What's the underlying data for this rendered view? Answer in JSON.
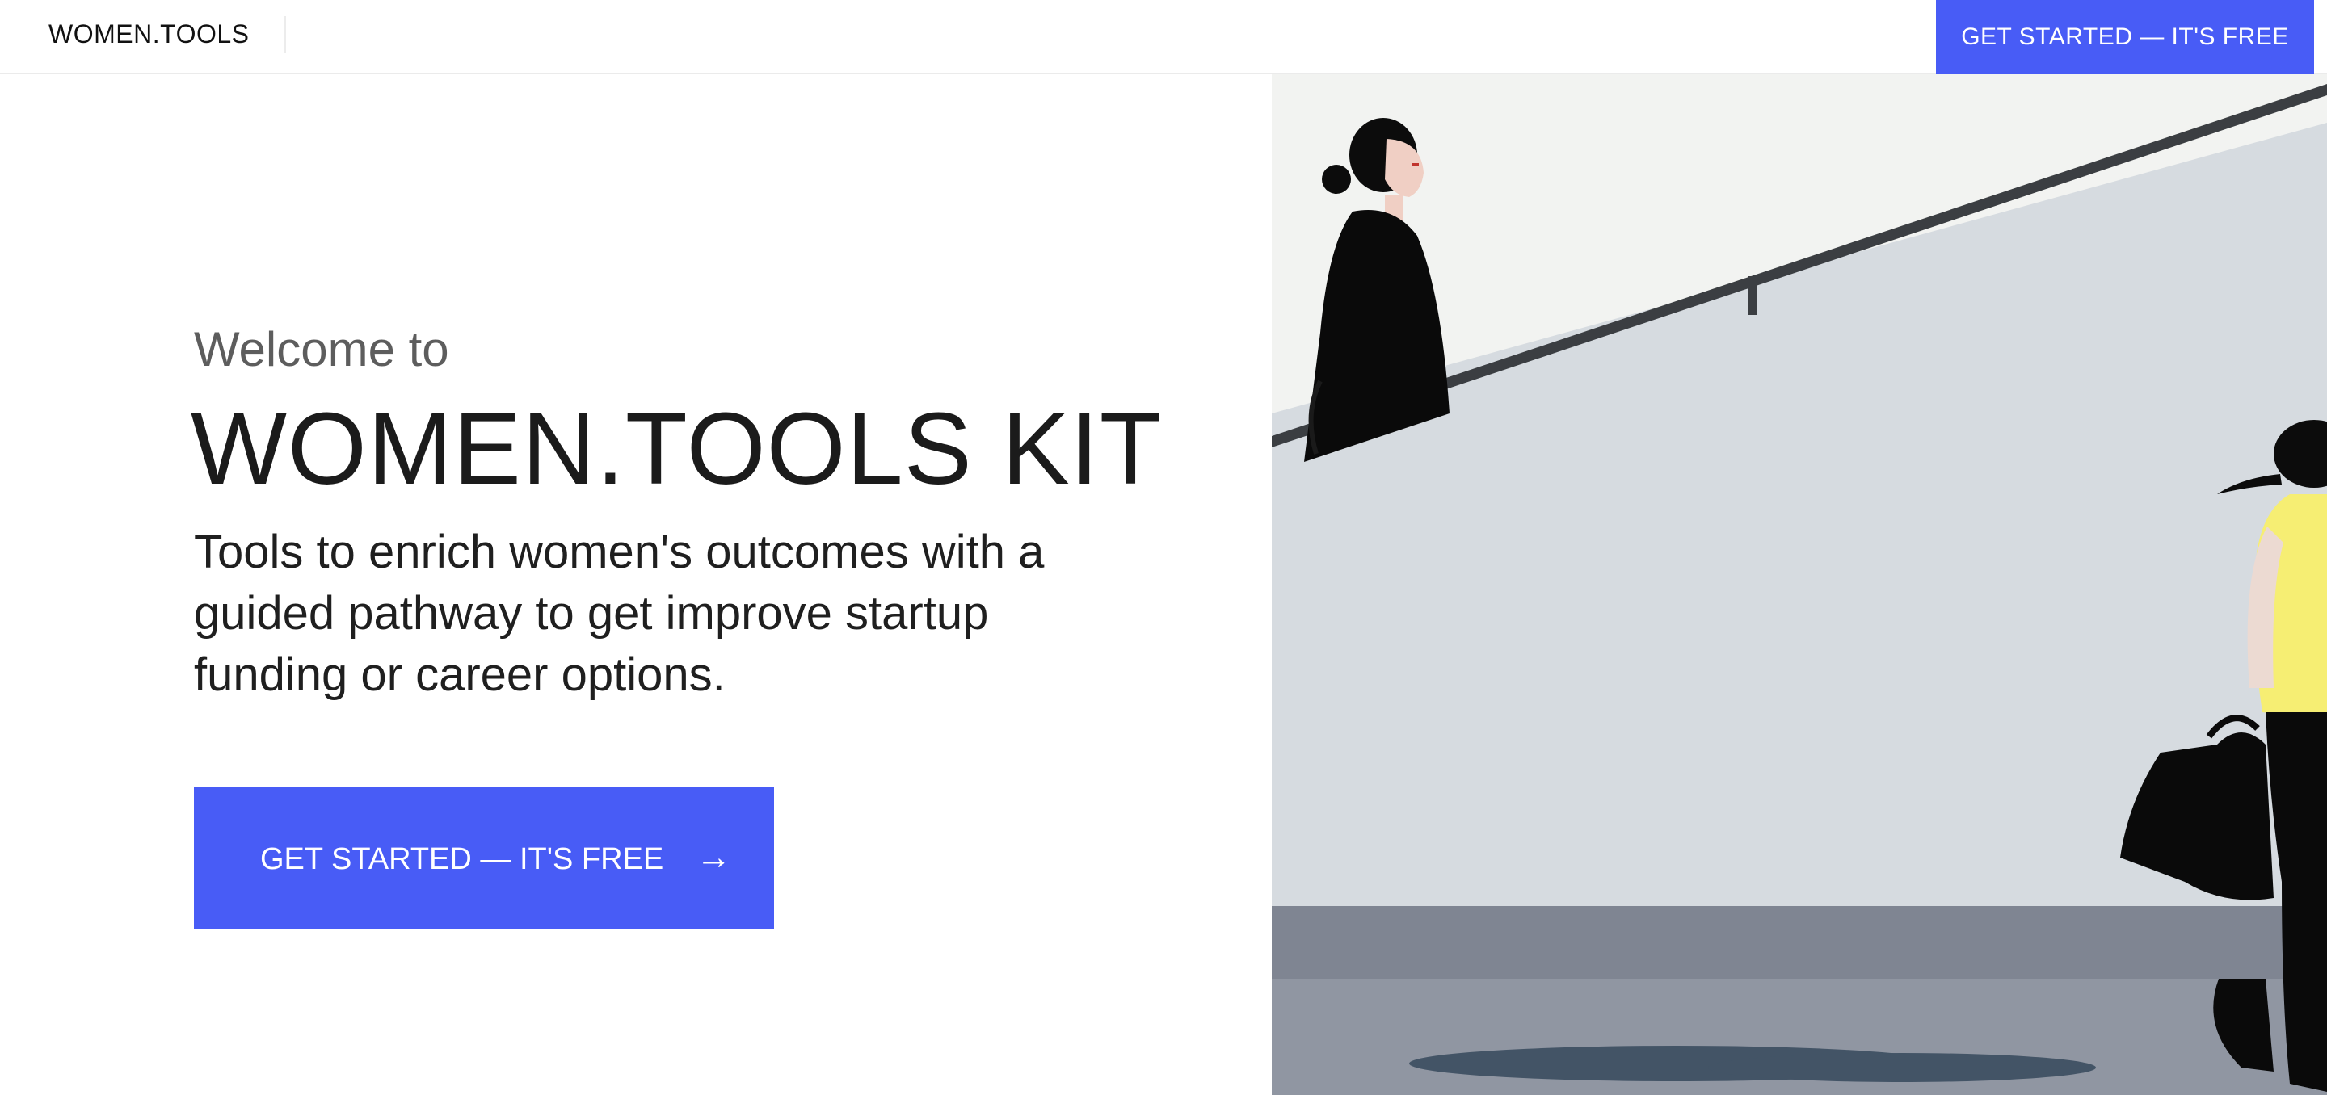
{
  "header": {
    "brand": "WOMEN.TOOLS",
    "cta_label": "GET STARTED — IT'S FREE"
  },
  "hero": {
    "welcome": "Welcome to",
    "title": "WOMEN.TOOLS KIT",
    "subtitle": "Tools to enrich women's outcomes with a guided pathway to get improve startup funding or career options.",
    "cta_label": "GET STARTED — IT'S FREE",
    "cta_arrow": "→"
  },
  "theme": {
    "accent": "#485cf6",
    "text_dark": "#1b1b1b",
    "text_muted": "#5d5d5d"
  },
  "illustration": {
    "subject": "two women walking up an escalator and a staircase"
  }
}
